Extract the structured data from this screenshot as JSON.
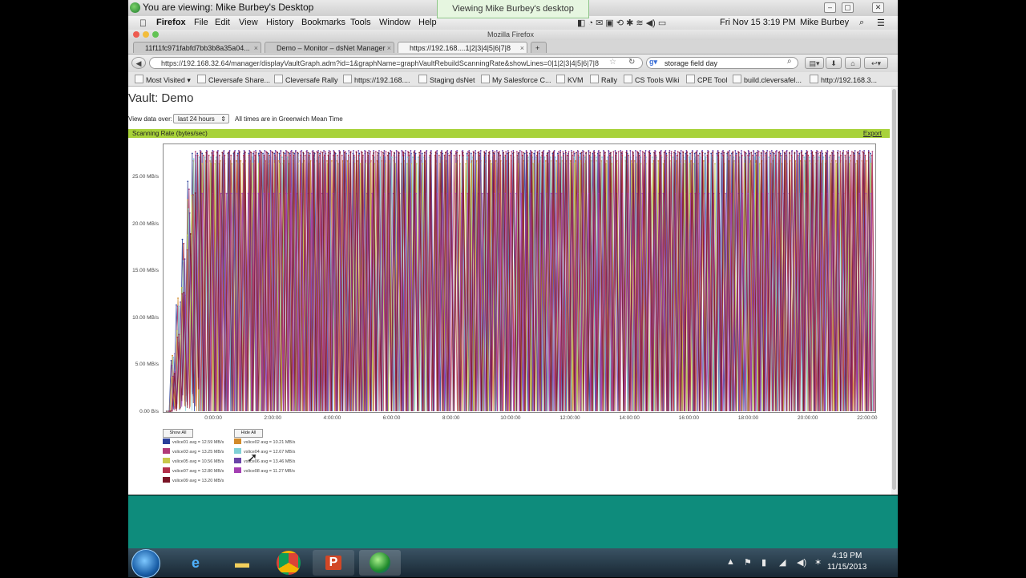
{
  "viewer": {
    "title": "You are viewing: Mike Burbey's Desktop",
    "banner": "Viewing Mike Burbey's desktop"
  },
  "mac_menu": {
    "app": "Firefox",
    "items": [
      "File",
      "Edit",
      "View",
      "History",
      "Bookmarks",
      "Tools",
      "Window",
      "Help"
    ],
    "clock": "Fri Nov 15  3:19 PM",
    "user": "Mike Burbey"
  },
  "firefox": {
    "window_title": "Mozilla Firefox",
    "tabs": [
      {
        "label": "11f11fc971fabfd7bb3b8a35a04..."
      },
      {
        "label": "Demo – Monitor – dsNet Manager"
      },
      {
        "label": "https://192.168....1|2|3|4|5|6|7|8"
      }
    ],
    "url": "https://192.168.32.64/manager/displayVaultGraph.adm?id=1&graphName=graphVaultRebuildScanningRate&showLines=0|1|2|3|4|5|6|7|8",
    "search_value": "storage field day",
    "bookmarks": [
      "Most Visited",
      "Cleversafe Share...",
      "Cleversafe Rally",
      "https://192.168....",
      "Staging dsNet",
      "My Salesforce C...",
      "KVM",
      "Rally",
      "CS Tools Wiki",
      "CPE Tool",
      "build.cleversafel...",
      "http://192.168.3..."
    ]
  },
  "page": {
    "title": "Vault: Demo",
    "view_label": "View data over:",
    "range_selected": "last 24 hours",
    "tz_note": "All times are in Greenwich Mean Time",
    "graph_title": "Scanning Rate (bytes/sec)",
    "export": "Export",
    "show_all": "Show All",
    "hide_all": "Hide All"
  },
  "chart_data": {
    "type": "line",
    "title": "Scanning Rate (bytes/sec)",
    "y_ticks": [
      "0.00 B/s",
      "5.00 MB/s",
      "10.00 MB/s",
      "15.00 MB/s",
      "20.00 MB/s",
      "25.00 MB/s"
    ],
    "ylim": [
      0,
      28.5
    ],
    "x_ticks": [
      "0:00:00",
      "2:00:00",
      "4:00:00",
      "6:00:00",
      "8:00:00",
      "10:00:00",
      "12:00:00",
      "14:00:00",
      "16:00:00",
      "18:00:00",
      "20:00:00",
      "22:00:00"
    ],
    "xlim_hours": [
      -1.7,
      22.3
    ],
    "series": [
      {
        "name": "vslice01 avg = 12.59 MB/s",
        "color": "#2a3f9a",
        "peak": 27.6
      },
      {
        "name": "vslice02 avg = 10.21 MB/s",
        "color": "#d18a2a",
        "peak": 26.8
      },
      {
        "name": "vslice03 avg = 13.25 MB/s",
        "color": "#b03a78",
        "peak": 27.8
      },
      {
        "name": "vslice04 avg = 12.67 MB/s",
        "color": "#7fd0d6",
        "peak": 27.2
      },
      {
        "name": "vslice05 avg = 10.56 MB/s",
        "color": "#c8c84a",
        "peak": 26.5
      },
      {
        "name": "vslice06 avg = 13.46 MB/s",
        "color": "#6a44a8",
        "peak": 27.9
      },
      {
        "name": "vslice07 avg = 12.80 MB/s",
        "color": "#b22f4a",
        "peak": 27.4
      },
      {
        "name": "vslice08 avg = 11.27 MB/s",
        "color": "#a33fb2",
        "peak": 23.3
      },
      {
        "name": "vslice09 avg = 13.20 MB/s",
        "color": "#7a1426",
        "peak": 27.7
      }
    ],
    "pattern": "rapid oscillation between 0 and peak throughout the 24h window, ramp-up at start"
  },
  "taskbar": {
    "clock_time": "4:19 PM",
    "clock_date": "11/15/2013"
  }
}
